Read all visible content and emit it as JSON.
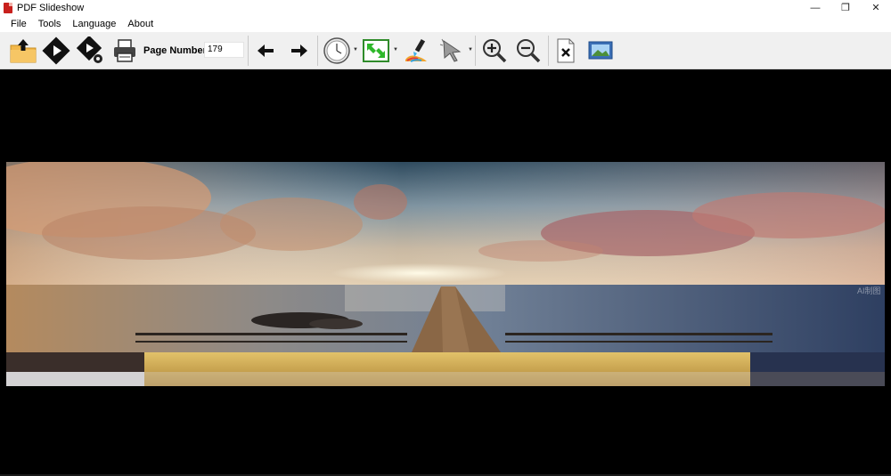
{
  "window": {
    "title": "PDF Slideshow",
    "controls": {
      "minimize": "—",
      "restore": "❐",
      "close": "✕"
    }
  },
  "menu": {
    "items": [
      {
        "label": "File"
      },
      {
        "label": "Tools"
      },
      {
        "label": "Language"
      },
      {
        "label": "About"
      }
    ]
  },
  "toolbar": {
    "page_number_label": "Page Number",
    "page_number_value": "179",
    "icons": [
      "open-folder-icon",
      "play-icon",
      "play-settings-icon",
      "printer-icon",
      "arrow-left-icon",
      "arrow-right-icon",
      "clock-icon",
      "fit-screen-icon",
      "color-brush-icon",
      "pointer-icon",
      "zoom-in-icon",
      "zoom-out-icon",
      "close-document-icon",
      "image-view-icon"
    ]
  },
  "slide": {
    "watermark": "AI制图"
  },
  "colors": {
    "titlebar_bg": "#ffffff",
    "toolbar_bg": "#f0f0f0",
    "viewer_bg": "#000000"
  }
}
